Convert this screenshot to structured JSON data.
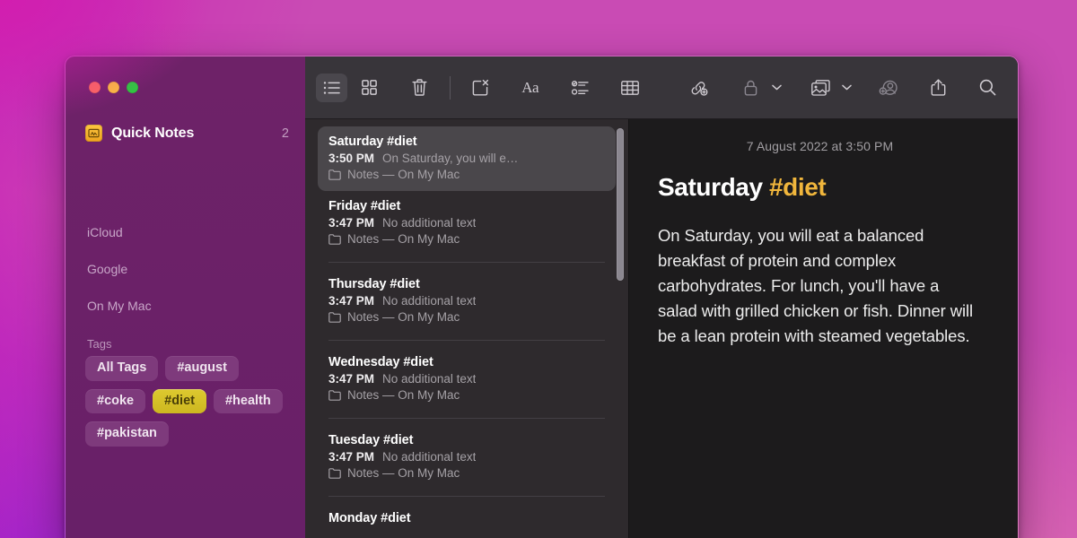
{
  "window": {
    "traffic_lights": [
      {
        "name": "close",
        "color": "#fe6a5d"
      },
      {
        "name": "minimize",
        "color": "#fdbf3e"
      },
      {
        "name": "zoom",
        "color": "#2dc93f"
      }
    ]
  },
  "sidebar": {
    "quick_notes": {
      "label": "Quick Notes",
      "count": "2",
      "icon": "quick-notes-icon"
    },
    "accounts": [
      {
        "label": "iCloud"
      },
      {
        "label": "Google"
      },
      {
        "label": "On My Mac"
      }
    ],
    "tags_heading": "Tags",
    "tags": [
      {
        "label": "All Tags",
        "selected": false
      },
      {
        "label": "#august",
        "selected": false
      },
      {
        "label": "#coke",
        "selected": false
      },
      {
        "label": "#diet",
        "selected": true
      },
      {
        "label": "#health",
        "selected": false
      },
      {
        "label": "#pakistan",
        "selected": false
      }
    ],
    "selected_tag_color": "#d8c12b",
    "background_color": "#6b2169"
  },
  "toolbar": {
    "items": [
      {
        "name": "list-view-icon",
        "label": "List View",
        "active": true,
        "dim": false
      },
      {
        "name": "gallery-view-icon",
        "label": "Gallery View",
        "active": false,
        "dim": false
      },
      {
        "name": "trash-icon",
        "label": "Delete Note",
        "active": false,
        "dim": false
      },
      {
        "name": "compose-icon",
        "label": "New Note",
        "active": false,
        "dim": false
      },
      {
        "name": "format-icon",
        "label": "Format (Aa)",
        "active": false,
        "dim": false
      },
      {
        "name": "checklist-icon",
        "label": "Checklist",
        "active": false,
        "dim": false
      },
      {
        "name": "table-icon",
        "label": "Table",
        "active": false,
        "dim": false
      },
      {
        "name": "add-link-icon",
        "label": "Add Link",
        "active": false,
        "dim": false
      },
      {
        "name": "lock-icon",
        "label": "Lock Note",
        "active": false,
        "dim": true
      },
      {
        "name": "media-icon",
        "label": "Insert Media",
        "active": false,
        "dim": false
      },
      {
        "name": "add-people-icon",
        "label": "Add People",
        "active": false,
        "dim": true
      },
      {
        "name": "share-icon",
        "label": "Share",
        "active": false,
        "dim": false
      },
      {
        "name": "search-icon",
        "label": "Search",
        "active": false,
        "dim": false
      }
    ],
    "format_label": "Aa"
  },
  "notes_list": {
    "notes": [
      {
        "title": "Saturday #diet",
        "time": "3:50 PM",
        "snippet": "On Saturday, you will e…",
        "folder": "Notes — On My Mac",
        "selected": true
      },
      {
        "title": "Friday #diet",
        "time": "3:47 PM",
        "snippet": "No additional text",
        "folder": "Notes — On My Mac",
        "selected": false
      },
      {
        "title": "Thursday #diet",
        "time": "3:47 PM",
        "snippet": "No additional text",
        "folder": "Notes — On My Mac",
        "selected": false
      },
      {
        "title": "Wednesday #diet",
        "time": "3:47 PM",
        "snippet": "No additional text",
        "folder": "Notes — On My Mac",
        "selected": false
      },
      {
        "title": "Tuesday #diet",
        "time": "3:47 PM",
        "snippet": "No additional text",
        "folder": "Notes — On My Mac",
        "selected": false
      },
      {
        "title": "Monday #diet",
        "time": "",
        "snippet": "",
        "folder": "",
        "selected": false
      }
    ]
  },
  "note_detail": {
    "date": "7 August 2022 at 3:50 PM",
    "title_main": "Saturday ",
    "title_tag": "#diet",
    "tag_color": "#f0b63c",
    "body": "On Saturday, you will eat a balanced breakfast of protein and complex carbohydrates. For lunch, you'll have a salad with grilled chicken or fish. Dinner will be a lean protein with steamed vegetables."
  }
}
